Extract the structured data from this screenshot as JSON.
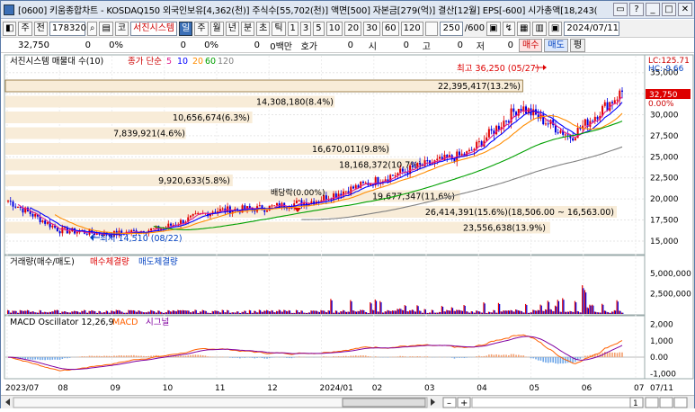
{
  "title": "[0600] 키움종합차트 - KOSDAQ150 외국인보유[4,362(천)] 주식수[55,702(천)] 액면[500] 자본금[279(억)] 결산[12월] EPS[-600] 시가총액[18,243(",
  "window_buttons": [
    "▭",
    "?",
    "_",
    "□",
    "✕"
  ],
  "toolbar": {
    "code_type": "주",
    "code_prefix": "전",
    "code": "178320",
    "market": "코",
    "name": "서진시스템",
    "periods": [
      "일",
      "주",
      "월",
      "년",
      "분",
      "초",
      "틱"
    ],
    "active_period": "일",
    "intervals": [
      "1",
      "3",
      "5",
      "10",
      "20",
      "30",
      "60",
      "120"
    ],
    "count": "250",
    "count_total": "/600",
    "date": "2024/07/11"
  },
  "quote": {
    "price": "32,750",
    "change": "0",
    "change_pct": "0%",
    "volume": "0",
    "volume_pct": "0%",
    "amount": "0",
    "amount_label": "0백만",
    "hoga": "호가",
    "open_v": "0",
    "open_l": "시",
    "high_v": "0",
    "high_l": "고",
    "low_v": "0",
    "low_l": "저",
    "close_v": "0",
    "buy": "매수",
    "sell": "매도",
    "flat": "평"
  },
  "price_panel": {
    "legend_title": "서진시스템 매물대 수(10)",
    "ma_label": "종가 단순",
    "ma_periods": [
      "5",
      "10",
      "20",
      "60",
      "120"
    ],
    "ma_colors": [
      "#e0208f",
      "#0000ff",
      "#ff8c00",
      "#00a000",
      "#808080"
    ],
    "lc": "LC:125.71",
    "hc": "HC:-9.66",
    "current": "32,750",
    "current_pct": "0.00%",
    "high_label": "최고 36,250 (05/27)",
    "low_label": "최저 14,510 (08/22)",
    "dividend_label": "배당락(0.00%)",
    "price_ticks": [
      "35,000",
      "32,500",
      "30,000",
      "27,500",
      "25,000",
      "22,500",
      "20,000",
      "17,500",
      "15,000"
    ],
    "volume_profile": [
      "22,395,417(13.2%)",
      "14,308,180(8.4%)",
      "10,656,674(6.3%)",
      "7,839,921(4.6%)",
      "16,670,011(9.8%)",
      "18,168,372(10.7%)",
      "9,920,633(5.8%)",
      "19,677,347(11.6%)",
      "26,414,391(15.6%)(18,506.00 ~ 16,563.00)",
      "23,556,638(13.9%)"
    ]
  },
  "volume_panel": {
    "title": "거래량(매수/매도)",
    "buy_label": "매수체결량",
    "sell_label": "매도체결량",
    "ticks": [
      "5,000,000",
      "2,500,000"
    ]
  },
  "macd_panel": {
    "title": "MACD Oscillator 12,26,9",
    "macd_label": "MACD",
    "signal_label": "시그널",
    "ticks": [
      "2,000",
      "1,000",
      "0.00",
      "-1,000"
    ]
  },
  "x_axis": [
    "2023/07",
    "08",
    "09",
    "10",
    "11",
    "12",
    "2024/01",
    "02",
    "03",
    "04",
    "05",
    "06",
    "07",
    "07/11"
  ],
  "scroll": {
    "zoom": "1"
  },
  "chart_data": {
    "type": "line",
    "title": "서진시스템",
    "x": [
      "2023/07",
      "08",
      "09",
      "10",
      "11",
      "12",
      "2024/01",
      "02",
      "03",
      "04",
      "05",
      "06",
      "07"
    ],
    "series": [
      {
        "name": "종가",
        "values": [
          19800,
          16300,
          15800,
          16500,
          18600,
          18900,
          19800,
          21800,
          23800,
          25400,
          31000,
          27400,
          32750
        ]
      },
      {
        "name": "120",
        "values": [
          null,
          null,
          17000,
          17100,
          17200,
          17400,
          17900,
          18600,
          19700,
          20700,
          22200,
          23200,
          25000
        ]
      },
      {
        "name": "60",
        "values": [
          18500,
          17900,
          16800,
          16700,
          17300,
          18200,
          19100,
          20300,
          21800,
          23300,
          25400,
          26500,
          28300
        ]
      }
    ],
    "ylim": [
      13500,
      37000
    ],
    "volume_ylim": [
      0,
      6000000
    ],
    "macd_ylim": [
      -1200,
      2300
    ]
  }
}
